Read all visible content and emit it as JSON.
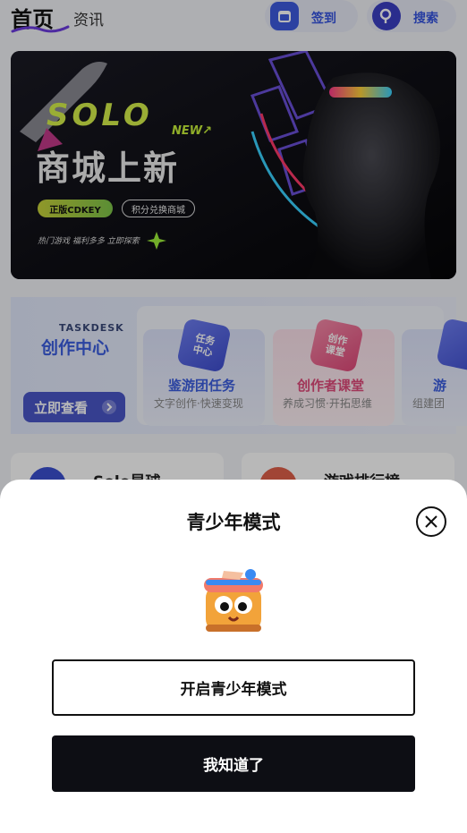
{
  "header": {
    "tab_home": "首页",
    "tab_news": "资讯",
    "sign_in_label": "签到",
    "search_label": "搜索"
  },
  "banner": {
    "brand": "SOLO",
    "new_tag": "NEW↗",
    "title": "商城上新",
    "tag_genuine": "正版CDKEY",
    "tag_points": "积分兑换商城",
    "subtitle": "热门游戏 福利多多 立即探索"
  },
  "taskdesk": {
    "en_title": "TASKDESK",
    "cn_title": "创作中心",
    "view_button": "立即查看",
    "cards": [
      {
        "cube": "任务\n中心",
        "title": "鉴游团任务",
        "sub": "文字创作·快速变现"
      },
      {
        "cube": "创作\n课堂",
        "title": "创作者课堂",
        "sub": "养成习惯·开拓思维"
      },
      {
        "cube": "",
        "title": "游",
        "sub": "组建团"
      }
    ]
  },
  "features": {
    "left_label": "Solo星球",
    "right_label": "游戏排行榜"
  },
  "sheet": {
    "title": "青少年模式",
    "enable_button": "开启青少年模式",
    "ok_button": "我知道了"
  },
  "colors": {
    "accent": "#3554e0",
    "dark_button": "#0d0e14",
    "sheet_bg": "#ffffff"
  }
}
